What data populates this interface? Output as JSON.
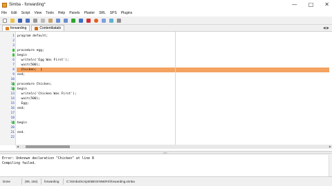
{
  "window": {
    "title": "Simba - forwarding*",
    "controls": [
      "minimize-icon",
      "maximize-icon",
      "close-icon"
    ]
  },
  "menu": [
    "File",
    "Edit",
    "Script",
    "View",
    "Tools",
    "Help",
    "Panels",
    "Plaster",
    "SRL",
    "SPS",
    "Plugins"
  ],
  "tabs": [
    {
      "label": "forwarding",
      "active": true
    },
    {
      "label": "Contentkatalo",
      "active": false
    }
  ],
  "editor": {
    "line_numbers": [
      "1",
      "2",
      "3",
      "4",
      "5",
      "6",
      "7",
      "8",
      "9",
      "10",
      "11",
      "12",
      "13",
      "14",
      "15",
      "16",
      "17",
      "18",
      "19",
      "20",
      "21",
      "22"
    ],
    "lines": [
      "program default;",
      "",
      "",
      "procedure egg;",
      "begin",
      "  writeln('Egg Was First');",
      "  wait(500);",
      "  Chicken;",
      "end;",
      "",
      "procedure Chicken;",
      "begin",
      "  writeln('Chicken Was First');",
      "  wait(500);",
      "  Egg;",
      "end;",
      "",
      "",
      "begin",
      "",
      "end.",
      ""
    ],
    "highlight_line": 8,
    "highlight_color": "#f4a360"
  },
  "output": {
    "lines": [
      "Error: Unknown declaration \"Chicken\" at line 8",
      "Compiling failed."
    ]
  },
  "status": {
    "mode": "Done",
    "cursor": "(95, 154)",
    "script": "forwarding",
    "path": "C:\\Simba\\Scripts\\BEGINNERS\\forwarding.simba"
  }
}
